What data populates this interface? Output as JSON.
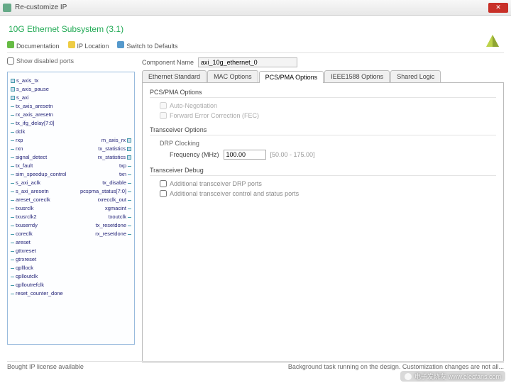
{
  "window": {
    "title": "Re-customize IP"
  },
  "ip_title": "10G Ethernet Subsystem (3.1)",
  "toolbar": {
    "doc": "Documentation",
    "loc": "IP Location",
    "sw": "Switch to Defaults"
  },
  "show_disabled_label": "Show disabled ports",
  "ports_left": [
    "+ s_axis_tx",
    "+ s_axis_pause",
    "+ s_axi",
    "tx_axis_aresetn",
    "rx_axis_aresetn",
    "tx_ifg_delay[7:0]",
    "dclk",
    "rxp",
    "rxn",
    "signal_detect",
    "tx_fault",
    "sim_speedup_control",
    "s_axi_aclk",
    "s_axi_aresetn",
    "areset_coreclk",
    "txusrclk",
    "txusrclk2",
    "txuserrdy",
    "coreclk",
    "areset",
    "gttxreset",
    "gtrxreset",
    "qplllock",
    "qplloutclk",
    "qplloutrefclk",
    "reset_counter_done"
  ],
  "ports_right": [
    "",
    "",
    "",
    "",
    "",
    "",
    "",
    "m_axis_rx +",
    "tx_statistics +",
    "rx_statistics +",
    "txp",
    "txn",
    "tx_disable",
    "pcspma_status[7:0]",
    "rxrecclk_out",
    "xgmacint",
    "txoutclk",
    "tx_resetdone",
    "rx_resetdone",
    "",
    "",
    "",
    "",
    "",
    "",
    ""
  ],
  "component": {
    "name_label": "Component Name",
    "name_value": "axi_10g_ethernet_0"
  },
  "tabs": {
    "t1": "Ethernet Standard",
    "t2": "MAC Options",
    "t3": "PCS/PMA Options",
    "t4": "IEEE1588 Options",
    "t5": "Shared Logic"
  },
  "pcs_pma": {
    "section": "PCS/PMA Options",
    "auto_neg": "Auto-Negotiation",
    "fec": "Forward Error Correction (FEC)",
    "transceiver_section": "Transceiver Options",
    "drp_clocking": "DRP Clocking",
    "freq_label": "Frequency (MHz)",
    "freq_value": "100.00",
    "freq_range": "[50.00 - 175.00]",
    "debug_section": "Transceiver Debug",
    "debug_drp": "Additional transceiver DRP ports",
    "debug_ctrl": "Additional transceiver control and status ports"
  },
  "footer": {
    "left": "Bought IP license available",
    "right": "Background task running on the design. Customization changes are not all..."
  },
  "watermark": "电子发烧友  www.elecfans.com"
}
